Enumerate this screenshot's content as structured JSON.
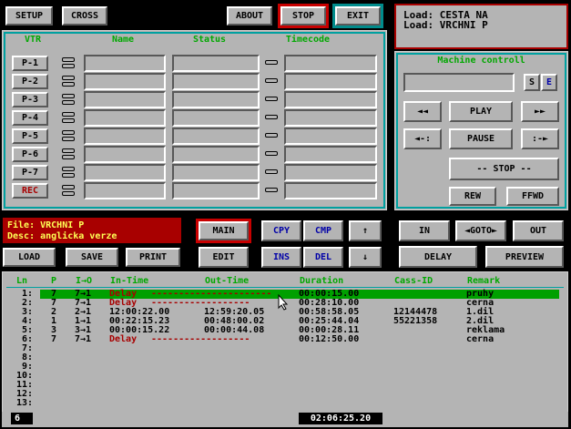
{
  "top_buttons": {
    "setup": "SETUP",
    "cross": "CROSS",
    "about": "ABOUT",
    "stop": "STOP",
    "exit": "EXIT"
  },
  "load_info": {
    "line1": "Load: CESTA NA",
    "line2": "Load: VRCHNI P"
  },
  "vtr_panel": {
    "headers": [
      "VTR",
      "Name",
      "Status",
      "Timecode"
    ],
    "rows": [
      "P-1",
      "P-2",
      "P-3",
      "P-4",
      "P-5",
      "P-6",
      "P-7",
      "REC"
    ]
  },
  "machine": {
    "title": "Machine controll",
    "s_label": "S",
    "e_label": "E",
    "rewind_glyph": "◄◄",
    "play": "PLAY",
    "ffwd_glyph": "►►",
    "prev_frame": "◄-:",
    "pause": "PAUSE",
    "next_frame": ":-►",
    "stop": "-- STOP --",
    "rew": "REW",
    "fwd": "FFWD"
  },
  "file_info": {
    "file": "File: VRCHNI P",
    "desc": "Desc: anglicka verze"
  },
  "mid_buttons": {
    "main": "MAIN",
    "cpy": "CPY",
    "cmp": "CMP",
    "up": "↑",
    "edit": "EDIT",
    "ins": "INS",
    "del": "DEL",
    "down": "↓",
    "load": "LOAD",
    "save": "SAVE",
    "print": "PRINT",
    "in": "IN",
    "goto": "◄GOTO►",
    "out": "OUT",
    "delay": "DELAY",
    "preview": "PREVIEW"
  },
  "list": {
    "headers": [
      "Ln",
      "P",
      "I→O",
      "In-Time",
      "Out-Time",
      "Duration",
      "Cass-ID",
      "Remark"
    ],
    "rows": [
      {
        "ln": "1:",
        "p": "7",
        "io": "7→1",
        "in": "Delay",
        "out": "----------------------",
        "dur": "00:00:15.00",
        "cass": "",
        "remark": "pruhy",
        "delay": true,
        "selected": true
      },
      {
        "ln": "2:",
        "p": "7",
        "io": "7→1",
        "in": "Delay",
        "out": "------------------",
        "dur": "00:28:10.00",
        "cass": "",
        "remark": "cerna",
        "delay": true,
        "selected": false
      },
      {
        "ln": "3:",
        "p": "2",
        "io": "2→1",
        "in": "12:00:22.00",
        "out": "12:59:20.05",
        "dur": "00:58:58.05",
        "cass": "12144478",
        "remark": "1.dil",
        "delay": false,
        "selected": false
      },
      {
        "ln": "4:",
        "p": "1",
        "io": "1→1",
        "in": "00:22:15.23",
        "out": "00:48:00.02",
        "dur": "00:25:44.04",
        "cass": "55221358",
        "remark": "2.dil",
        "delay": false,
        "selected": false
      },
      {
        "ln": "5:",
        "p": "3",
        "io": "3→1",
        "in": "00:00:15.22",
        "out": "00:00:44.08",
        "dur": "00:00:28.11",
        "cass": "",
        "remark": "reklama",
        "delay": false,
        "selected": false
      },
      {
        "ln": "6:",
        "p": "7",
        "io": "7→1",
        "in": "Delay",
        "out": "------------------",
        "dur": "00:12:50.00",
        "cass": "",
        "remark": "cerna",
        "delay": true,
        "selected": false
      },
      {
        "ln": "7:"
      },
      {
        "ln": "8:"
      },
      {
        "ln": "9:"
      },
      {
        "ln": "10:"
      },
      {
        "ln": "11:"
      },
      {
        "ln": "12:"
      },
      {
        "ln": "13:"
      }
    ]
  },
  "status": {
    "count": "6",
    "total": "02:06:25.20"
  },
  "colors": {
    "panel": "#b4b4b4",
    "accent_green": "#00a800",
    "accent_red": "#a80000",
    "selection": "#00a000",
    "blue_text": "#0000a8"
  }
}
